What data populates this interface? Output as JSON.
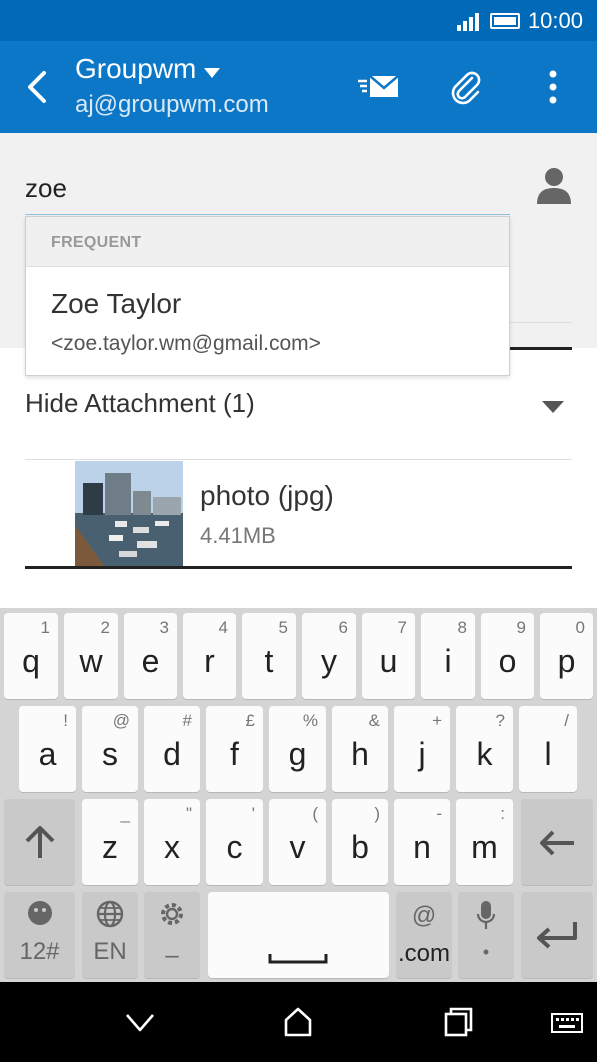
{
  "status_bar": {
    "time": "10:00"
  },
  "app_bar": {
    "account_name": "Groupwm",
    "account_email": "aj@groupwm.com"
  },
  "compose": {
    "to_value": "zoe",
    "suggestions": {
      "header": "FREQUENT",
      "items": [
        {
          "name": "Zoe Taylor",
          "email": "<zoe.taylor.wm@gmail.com>"
        }
      ]
    },
    "attachments": {
      "toggle_label": "Hide Attachment (1)",
      "items": [
        {
          "name": "photo (jpg)",
          "size": "4.41MB"
        }
      ]
    }
  },
  "keyboard": {
    "row1": [
      {
        "key": "q",
        "hint": "1"
      },
      {
        "key": "w",
        "hint": "2"
      },
      {
        "key": "e",
        "hint": "3"
      },
      {
        "key": "r",
        "hint": "4"
      },
      {
        "key": "t",
        "hint": "5"
      },
      {
        "key": "y",
        "hint": "6"
      },
      {
        "key": "u",
        "hint": "7"
      },
      {
        "key": "i",
        "hint": "8"
      },
      {
        "key": "o",
        "hint": "9"
      },
      {
        "key": "p",
        "hint": "0"
      }
    ],
    "row2": [
      {
        "key": "a",
        "hint": "!"
      },
      {
        "key": "s",
        "hint": "@"
      },
      {
        "key": "d",
        "hint": "#"
      },
      {
        "key": "f",
        "hint": "£"
      },
      {
        "key": "g",
        "hint": "%"
      },
      {
        "key": "h",
        "hint": "&"
      },
      {
        "key": "j",
        "hint": "+"
      },
      {
        "key": "k",
        "hint": "?"
      },
      {
        "key": "l",
        "hint": "/"
      }
    ],
    "row3": [
      {
        "key": "z",
        "hint": "_"
      },
      {
        "key": "x",
        "hint": "\""
      },
      {
        "key": "c",
        "hint": "'"
      },
      {
        "key": "v",
        "hint": "("
      },
      {
        "key": "b",
        "hint": ")"
      },
      {
        "key": "n",
        "hint": "-"
      },
      {
        "key": "m",
        "hint": ":"
      }
    ],
    "symbols_label": "12#",
    "language_label": "EN",
    "settings_label": "–",
    "at_label": "@",
    "dotcom_label": ".com",
    "mic_label": "•"
  }
}
